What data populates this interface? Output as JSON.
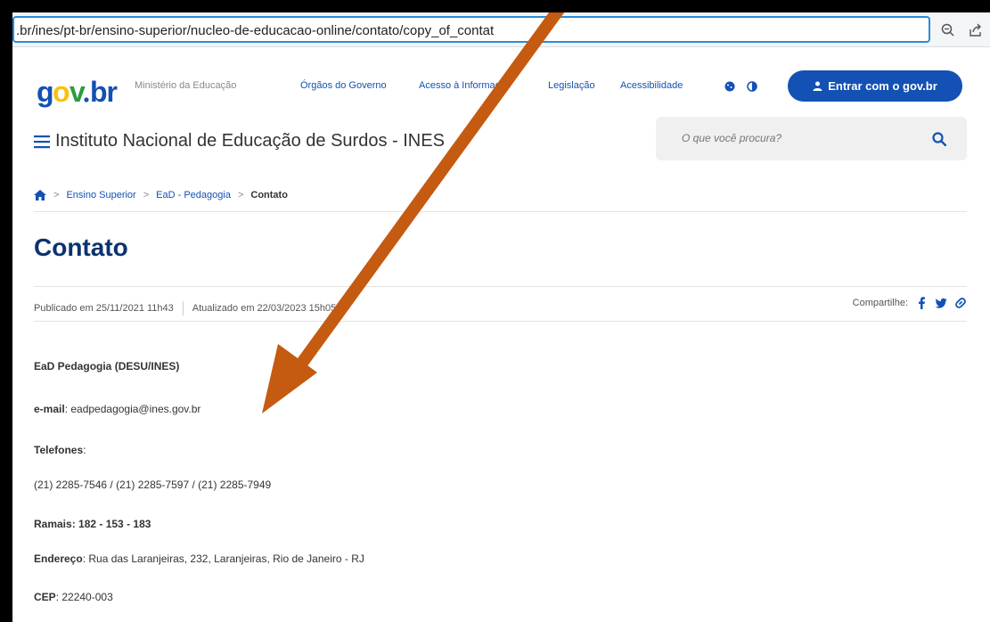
{
  "browser": {
    "url": ".br/ines/pt-br/ensino-superior/nucleo-de-educacao-online/contato/copy_of_contat"
  },
  "govbar": {
    "logo": "gov.br",
    "ministry": "Ministério da Educação",
    "links": [
      "Órgãos do Governo",
      "Acesso à Informação",
      "Legislação",
      "Acessibilidade"
    ],
    "login_label": "Entrar com o gov.br"
  },
  "header": {
    "site_title": "Instituto Nacional de Educação de Surdos - INES",
    "search_placeholder": "O que você procura?"
  },
  "breadcrumb": {
    "items": [
      "Ensino Superior",
      "EaD - Pedagogia"
    ],
    "current": "Contato"
  },
  "page": {
    "title": "Contato",
    "published": "Publicado em 25/11/2021 11h43",
    "updated": "Atualizado em 22/03/2023 15h05",
    "share_label": "Compartilhe:"
  },
  "content": {
    "org": "EaD Pedagogia (DESU/INES)",
    "email_label": "e-mail",
    "email_value": ": eadpedagogia@ines.gov.br",
    "phones_label": "Telefones",
    "phones_colon": ":",
    "phones_value": "(21) 2285-7546 / (21) 2285-7597 / (21) 2285-7949",
    "ramais": "Ramais: 182 - 153 - 183",
    "address_label": "Endereço",
    "address_value": ": Rua das Laranjeiras, 232, Laranjeiras, Rio de Janeiro - RJ",
    "cep_label": "CEP",
    "cep_value": ": 22240-003"
  },
  "colors": {
    "brand_blue": "#1351b4",
    "title_blue": "#0c326f",
    "arrow": "#c55a11"
  }
}
